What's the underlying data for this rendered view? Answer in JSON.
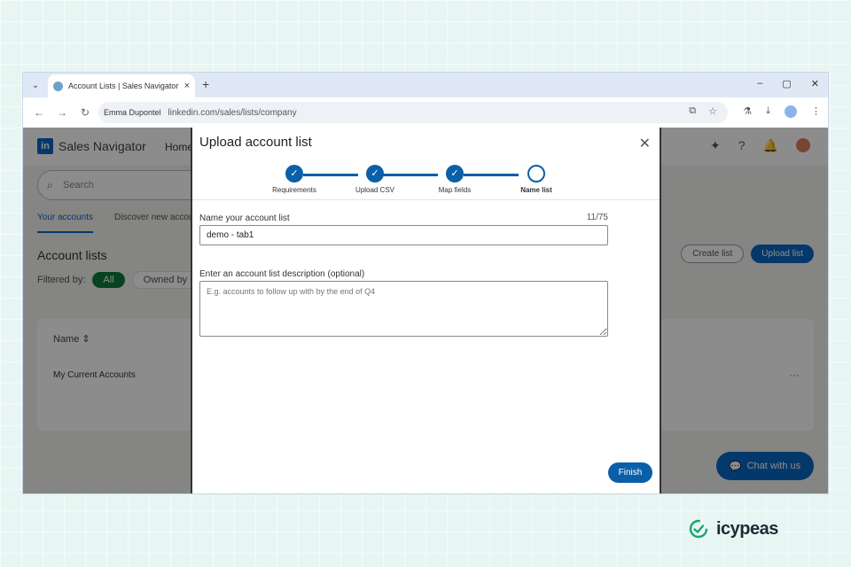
{
  "browser": {
    "tab_title": "Account Lists | Sales Navigator",
    "tab_close": "×",
    "new_tab": "+",
    "menu_icon": "⌄",
    "site_info": "Emma Dupontel",
    "url": "linkedin.com/sales/lists/company",
    "window_minimize": "–",
    "window_restore": "▢",
    "window_close": "✕"
  },
  "page": {
    "brand": "Sales Navigator",
    "home": "Home",
    "search_placeholder": "Search",
    "tabs": [
      "Your accounts",
      "Discover new accounts"
    ],
    "title": "Account lists",
    "filter_label": "Filtered by:",
    "filter_all": "All",
    "filter_owned": "Owned by me",
    "create_list": "Create list",
    "upload_list": "Upload list",
    "table_header": "Name",
    "row_name": "My Current Accounts",
    "row_more": "···",
    "chat_label": "Chat with us"
  },
  "modal": {
    "title": "Upload account list",
    "close": "✕",
    "steps": [
      {
        "label": "Requirements",
        "done": true
      },
      {
        "label": "Upload CSV",
        "done": true
      },
      {
        "label": "Map fields",
        "done": true
      },
      {
        "label": "Name list",
        "done": false
      }
    ],
    "name_label": "Name your account list",
    "name_counter": "11/75",
    "name_value": "demo - tab1",
    "desc_label": "Enter an account list description (optional)",
    "desc_placeholder": "E.g. accounts to follow up with by the end of Q4",
    "finish": "Finish"
  },
  "footer_brand": {
    "name": "icypeas",
    "color": "#1c2b36",
    "accent": "#17a673"
  }
}
